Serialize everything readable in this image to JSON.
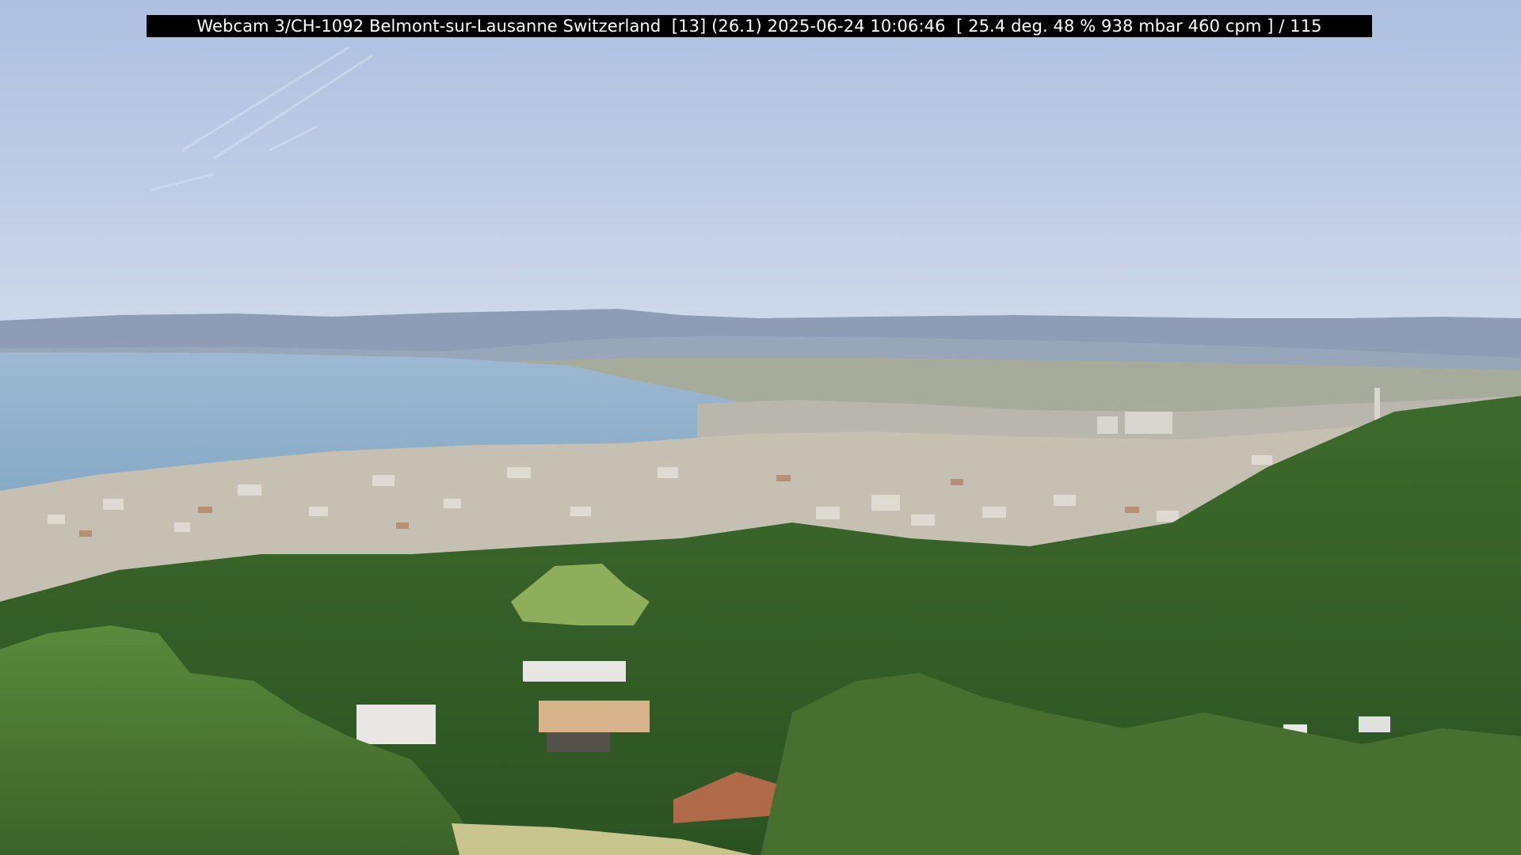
{
  "overlay": {
    "caption": "Webcam 3/CH-1092 Belmont-sur-Lausanne Switzerland  [13] (26.1) 2025-06-24 10:06:46  [ 25.4 deg. 48 % 938 mbar 460 cpm ] / 115"
  },
  "scene": {
    "subject": "panoramic-view-lake-and-town",
    "colors": {
      "sky_top": "#b3c4e3",
      "sky_horizon": "#c9d5ea",
      "mountains": "#8d9bb4",
      "lake": "#8fb1cc",
      "town": "#c9c2b5",
      "forest": "#3f6a2e",
      "foreground_trees": "#4f7a35"
    }
  }
}
